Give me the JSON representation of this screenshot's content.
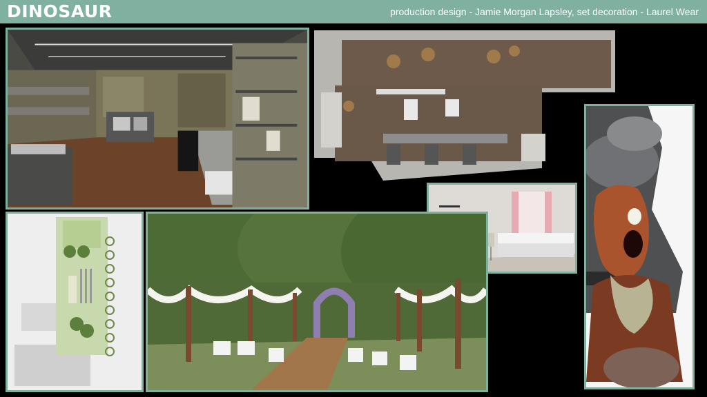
{
  "header": {
    "title": "DINOSAUR",
    "credits": "production design - Jamie Morgan Lapsley, set decoration - Laurel Wear"
  },
  "colors": {
    "header_bar": "#7fb0a0",
    "background": "#000000",
    "frame": "#7fb0a0"
  },
  "panels": [
    {
      "name": "office-interior-sketch"
    },
    {
      "name": "warehouse-floor-plan"
    },
    {
      "name": "bedroom-sketch"
    },
    {
      "name": "garden-site-plan"
    },
    {
      "name": "outdoor-ceremony-rendering"
    },
    {
      "name": "zombie-poster-art"
    }
  ]
}
